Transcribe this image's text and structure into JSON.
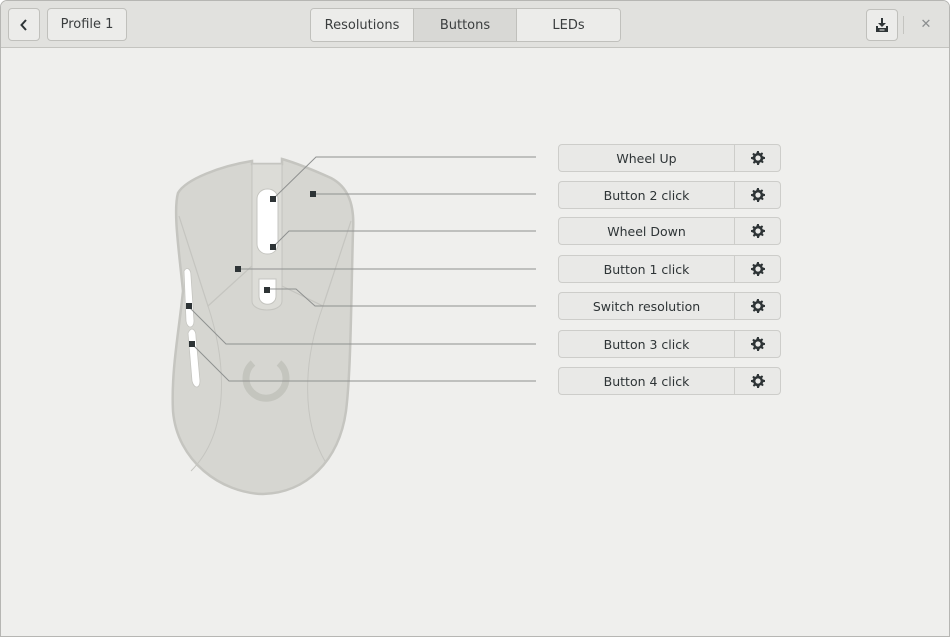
{
  "header": {
    "back_icon": "chevron-left-icon",
    "profile_label": "Profile 1",
    "tabs": [
      {
        "label": "Resolutions",
        "active": false
      },
      {
        "label": "Buttons",
        "active": true
      },
      {
        "label": "LEDs",
        "active": false
      }
    ],
    "save_icon": "download-icon",
    "close_icon": "close-icon",
    "close_glyph": "✕"
  },
  "buttons": [
    {
      "label": "Wheel Up",
      "settings_icon": "gear-icon"
    },
    {
      "label": "Button 2 click",
      "settings_icon": "gear-icon"
    },
    {
      "label": "Wheel Down",
      "settings_icon": "gear-icon"
    },
    {
      "label": "Button 1 click",
      "settings_icon": "gear-icon"
    },
    {
      "label": "Switch resolution",
      "settings_icon": "gear-icon"
    },
    {
      "label": "Button 3 click",
      "settings_icon": "gear-icon"
    },
    {
      "label": "Button 4 click",
      "settings_icon": "gear-icon"
    }
  ],
  "colors": {
    "mouse_body": "#d6d6d1",
    "mouse_outline": "#c5c5c0",
    "leader_line": "#8f9190",
    "marker": "#2e3436"
  }
}
